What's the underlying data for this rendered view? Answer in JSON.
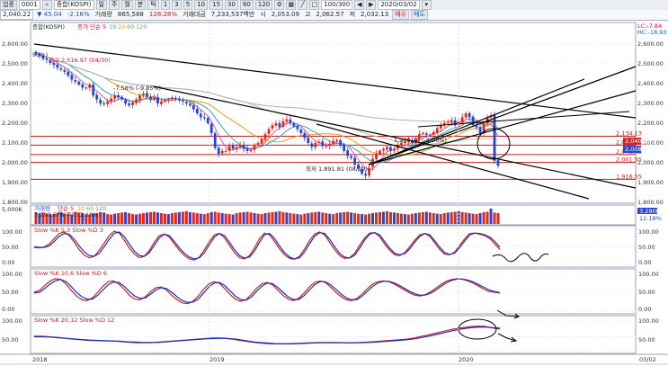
{
  "toolbar": {
    "mode": "업종",
    "code": "0001",
    "name": "종합(KOSPI)",
    "periods": [
      "일",
      "주",
      "월",
      "분",
      "틱"
    ],
    "minutes": [
      "1",
      "3",
      "5",
      "10",
      "15",
      "30",
      "60",
      "120"
    ],
    "count": "100/300",
    "date": "2020/03/02",
    "buy_label": "매수",
    "sell_label": "매도"
  },
  "quote": {
    "price": "2,040.22",
    "change": "▼ 45.04",
    "rate": "-2.16%",
    "volume_label": "거래량",
    "volume": "865,588",
    "volume_rate": "128.28%",
    "amount_label": "거래대금",
    "amount": "7,233,537백만",
    "open_label": "시",
    "open": "2,053.09",
    "high_label": "고",
    "high": "2,062.57",
    "low_label": "저",
    "low": "2,032.13"
  },
  "colors": {
    "up": "#e0281e",
    "down": "#2346d6",
    "ma5": "#e05a9c",
    "ma10": "#2aa7a7",
    "ma20": "#e0a020",
    "ma60": "#a8c8a0",
    "ma120": "#b0b0b0",
    "hline": "#c81a1a",
    "trend": "#000000",
    "slowk": "#cc2020",
    "slowd": "#1530c0"
  },
  "chart_data": [
    {
      "type": "candlestick",
      "title": "종합(KOSPI)",
      "legend": [
        "종가 단순 5",
        "10",
        "20",
        "60",
        "120"
      ],
      "ylim": [
        1800,
        2700
      ],
      "y_ticks": [
        "2,600.00",
        "2,500.00",
        "2,400.00",
        "2,300.00",
        "2,200.00",
        "2,100.00",
        "2,000.00",
        "1,900.00",
        "1,800.00"
      ],
      "x_labels": [
        "2018",
        "2019",
        "2020",
        "03/02"
      ],
      "top_right_labels": [
        "LC:-7.84",
        "HC:-18.93"
      ],
      "close": [
        2550,
        2540,
        2525,
        2520,
        2505,
        2495,
        2480,
        2470,
        2460,
        2440,
        2420,
        2410,
        2395,
        2380,
        2380,
        2395,
        2340,
        2320,
        2300,
        2295,
        2310,
        2325,
        2340,
        2330,
        2320,
        2300,
        2290,
        2305,
        2320,
        2340,
        2350,
        2335,
        2320,
        2330,
        2300,
        2310,
        2315,
        2320,
        2330,
        2325,
        2315,
        2310,
        2300,
        2290,
        2270,
        2250,
        2230,
        2225,
        2200,
        2150,
        2075,
        2045,
        2060,
        2060,
        2085,
        2070,
        2080,
        2090,
        2070,
        2060,
        2065,
        2090,
        2100,
        2120,
        2145,
        2170,
        2190,
        2200,
        2180,
        2210,
        2220,
        2200,
        2185,
        2170,
        2150,
        2125,
        2100,
        2080,
        2100,
        2105,
        2085,
        2085,
        2095,
        2110,
        2115,
        2090,
        2060,
        2035,
        2025,
        1990,
        1970,
        1945,
        1935,
        1975,
        2020,
        2045,
        2060,
        2070,
        2080,
        2060,
        2070,
        2090,
        2100,
        2105,
        2115,
        2100,
        2120,
        2145,
        2150,
        2140,
        2140,
        2155,
        2175,
        2190,
        2200,
        2205,
        2215,
        2190,
        2205,
        2230,
        2250,
        2230,
        2190,
        2180,
        2150,
        2200,
        2230,
        2240,
        2010,
        1985
      ],
      "horizontal_lines": [
        2134.13,
        2089.13,
        2041.53,
        2001.55,
        1916.55
      ],
      "horizontal_line_labels": [
        "2,134.13",
        "2,089.13",
        "2,041.53",
        "2,001.55",
        "1,916.55"
      ],
      "right_marker_labels": [
        "2,040.22",
        "2,008.32"
      ],
      "annotations": [
        "93%)",
        "최고 2,516.97 (04/30)",
        "-7.58% (-9.85%)",
        "최저 1,891.81 (08/19)",
        "1,908.28 (-4.26%)"
      ]
    },
    {
      "type": "bar",
      "title": "거래량",
      "legend": [
        "단순 5",
        "20",
        "60",
        "120"
      ],
      "sub_label": "3,290,678(주)(12.18%)",
      "y_ticks": [
        "5,000K"
      ],
      "right_labels": [
        "3,290K",
        "12.18%"
      ],
      "values": [
        60,
        55,
        58,
        52,
        50,
        48,
        55,
        60,
        52,
        50,
        48,
        62,
        58,
        55,
        50,
        48,
        52,
        55,
        60,
        58,
        50,
        48,
        52,
        55,
        58,
        60,
        55,
        50,
        48,
        52,
        55,
        58,
        60,
        62,
        58,
        55,
        52,
        50,
        55,
        58,
        60,
        62,
        65,
        60,
        58,
        55,
        52,
        50,
        55,
        60,
        62,
        58,
        55,
        52,
        50,
        48,
        55,
        58,
        60,
        62,
        58,
        55,
        52,
        50,
        55,
        58,
        60,
        62,
        65,
        60,
        58,
        55,
        52,
        50,
        48,
        52,
        55,
        58,
        60,
        62,
        58,
        55,
        52,
        50,
        55,
        58,
        60,
        62,
        58,
        55,
        52,
        50,
        48,
        52,
        55,
        58,
        60,
        62,
        65,
        60,
        58,
        55,
        52,
        50,
        48,
        52,
        55,
        58,
        60,
        62,
        58,
        55,
        52,
        50,
        55,
        58,
        60,
        62,
        65,
        60,
        58,
        55,
        52,
        50,
        55,
        60,
        62,
        78,
        58,
        55
      ]
    },
    {
      "type": "line",
      "title": "Slow %K 5,3  Slow %D 3",
      "ylim": [
        0,
        100
      ],
      "y_ticks": [
        "100.00",
        "50.00",
        "0.00"
      ],
      "series": [
        {
          "name": "Slow %K 5,3",
          "values": [
            46,
            45,
            47,
            55,
            70,
            84,
            88,
            78,
            60,
            40,
            25,
            18,
            22,
            38,
            58,
            78,
            90,
            85,
            65,
            45,
            28,
            18,
            22,
            38,
            60,
            78,
            82,
            74,
            55,
            38,
            24,
            15,
            12,
            20,
            40,
            62,
            80,
            84,
            72,
            52,
            32,
            18,
            15,
            24,
            45,
            70,
            85,
            80,
            62,
            42,
            26,
            16,
            14,
            22,
            42,
            65,
            82,
            88,
            80,
            60,
            40,
            24,
            16,
            18,
            30,
            52,
            72,
            85,
            86,
            75,
            55,
            38,
            26,
            24,
            32,
            48,
            66,
            80,
            84,
            76,
            58,
            40,
            28,
            26,
            34,
            52,
            70,
            84,
            85,
            82,
            78,
            70,
            55,
            40
          ]
        },
        {
          "name": "Slow %D 3",
          "values": [
            48,
            46,
            46,
            50,
            62,
            76,
            84,
            82,
            68,
            50,
            34,
            24,
            22,
            30,
            48,
            68,
            84,
            88,
            75,
            55,
            36,
            24,
            22,
            32,
            52,
            72,
            82,
            78,
            62,
            45,
            30,
            20,
            15,
            18,
            32,
            54,
            74,
            84,
            78,
            60,
            40,
            24,
            17,
            20,
            36,
            60,
            80,
            84,
            70,
            50,
            32,
            20,
            15,
            18,
            34,
            56,
            76,
            86,
            84,
            68,
            48,
            30,
            20,
            17,
            25,
            44,
            66,
            82,
            86,
            80,
            62,
            44,
            30,
            26,
            29,
            42,
            60,
            76,
            84,
            80,
            64,
            46,
            32,
            27,
            31,
            46,
            64,
            80,
            85,
            84,
            80,
            74,
            62,
            46
          ]
        }
      ]
    },
    {
      "type": "line",
      "title": "Slow %K 10,6  Slow %D 6",
      "ylim": [
        0,
        100
      ],
      "y_ticks": [
        "100.00",
        "50.00",
        "0.00"
      ],
      "series": [
        {
          "name": "Slow %K 10,6",
          "values": [
            50,
            55,
            68,
            80,
            86,
            84,
            72,
            55,
            40,
            30,
            28,
            35,
            50,
            66,
            78,
            80,
            72,
            58,
            42,
            32,
            30,
            38,
            52,
            62,
            64,
            56,
            42,
            30,
            22,
            20,
            26,
            40,
            58,
            72,
            78,
            74,
            60,
            44,
            32,
            26,
            30,
            44,
            60,
            72,
            76,
            70,
            56,
            42,
            32,
            28,
            34,
            48,
            64,
            76,
            80,
            76,
            64,
            50,
            38,
            30,
            28,
            34,
            46,
            60,
            72,
            78,
            80,
            78,
            72,
            64,
            56,
            48,
            42,
            40,
            44,
            52,
            62,
            72,
            80,
            84,
            86,
            84,
            80,
            74,
            66,
            58,
            52,
            50,
            48
          ]
        },
        {
          "name": "Slow %D 6",
          "values": [
            48,
            50,
            60,
            72,
            80,
            84,
            78,
            65,
            50,
            38,
            32,
            32,
            42,
            56,
            70,
            77,
            76,
            66,
            52,
            40,
            34,
            35,
            45,
            56,
            62,
            60,
            50,
            38,
            28,
            23,
            24,
            32,
            48,
            64,
            74,
            76,
            68,
            54,
            40,
            31,
            29,
            37,
            52,
            66,
            74,
            73,
            63,
            50,
            38,
            31,
            31,
            41,
            56,
            70,
            78,
            78,
            70,
            58,
            45,
            35,
            30,
            31,
            40,
            53,
            66,
            75,
            79,
            79,
            75,
            68,
            60,
            52,
            46,
            42,
            43,
            48,
            57,
            67,
            76,
            82,
            85,
            85,
            82,
            77,
            70,
            63,
            56,
            52,
            49
          ]
        }
      ]
    },
    {
      "type": "line",
      "title": "Slow %K 20,12  Slow %D 12",
      "ylim": [
        0,
        100
      ],
      "y_ticks": [
        "100.00",
        "50.00"
      ],
      "series": [
        {
          "name": "Slow %K 20,12",
          "values": [
            52,
            52,
            50,
            48,
            45,
            42,
            40,
            38,
            37,
            36,
            36,
            34,
            32,
            30,
            30,
            30,
            32,
            34,
            36,
            38,
            40,
            42,
            44,
            46,
            46,
            44,
            40,
            36,
            32,
            29,
            27,
            26,
            26,
            27,
            28,
            29,
            30,
            31,
            31,
            31,
            30,
            30,
            31,
            32,
            34,
            36,
            38,
            40,
            42,
            46,
            52,
            58,
            64,
            70,
            76,
            80,
            84,
            86,
            85,
            80,
            76
          ]
        },
        {
          "name": "Slow %D 12",
          "values": [
            50,
            50,
            49,
            47,
            45,
            43,
            41,
            39,
            38,
            37,
            36,
            35,
            33,
            32,
            31,
            31,
            31,
            33,
            35,
            37,
            39,
            41,
            43,
            44,
            45,
            44,
            42,
            38,
            34,
            31,
            29,
            27,
            26,
            26,
            27,
            28,
            29,
            30,
            30,
            30,
            30,
            30,
            30,
            31,
            32,
            34,
            36,
            38,
            40,
            43,
            48,
            53,
            59,
            65,
            71,
            76,
            80,
            82,
            83,
            81,
            79
          ]
        }
      ]
    }
  ]
}
